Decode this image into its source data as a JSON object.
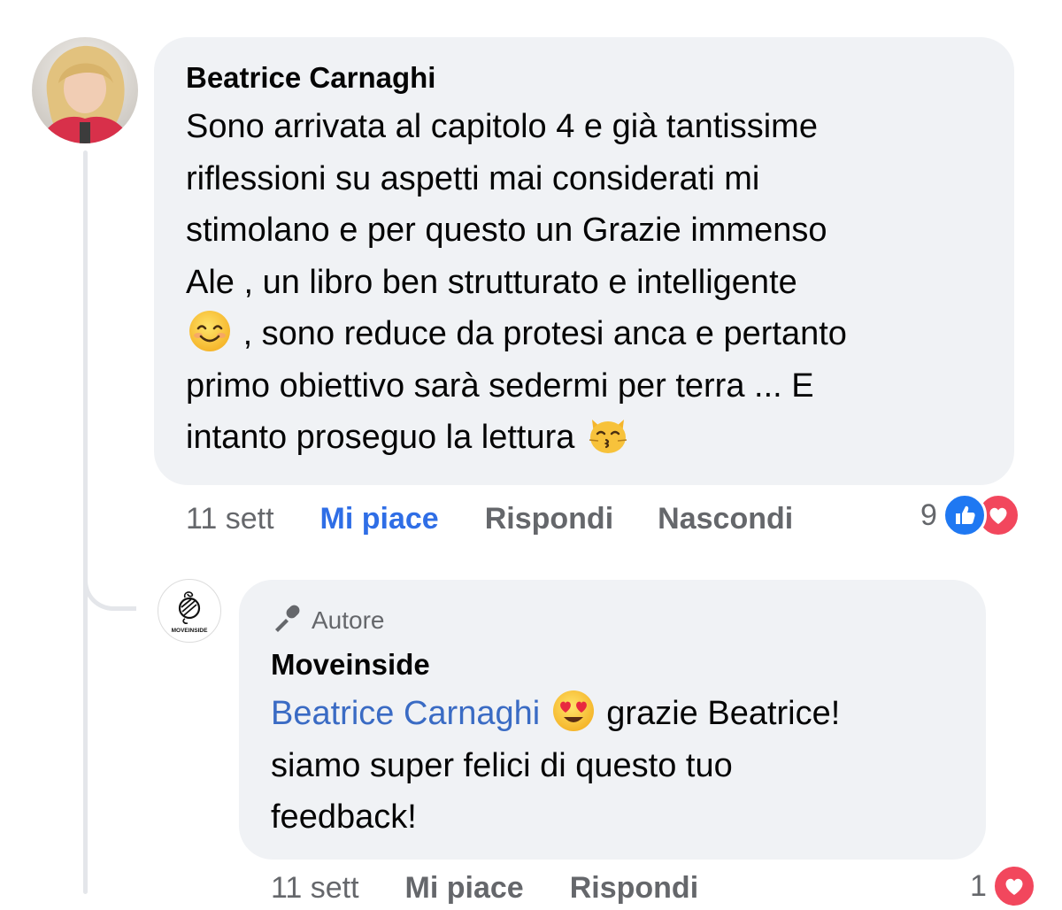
{
  "comment": {
    "author": "Beatrice Carnaghi",
    "lines": [
      "Sono arrivata al capitolo 4 e già tantissime",
      "riflessioni su aspetti mai considerati mi",
      "stimolano e per questo un Grazie immenso",
      "Ale , un libro ben strutturato e intelligente",
      ", sono reduce da protesi anca e pertanto",
      "primo obiettivo sarà sedermi per terra ... E",
      "intanto proseguo la lettura"
    ],
    "timestamp": "11 sett",
    "like_label": "Mi piace",
    "reply_label": "Rispondi",
    "hide_label": "Nascondi",
    "reaction_count": "9",
    "emojis": [
      "smiling-face-emoji",
      "kissing-cat-emoji"
    ]
  },
  "reply": {
    "badge_label": "Autore",
    "author": "Moveinside",
    "mention": "Beatrice Carnaghi",
    "line1_rest": "grazie Beatrice!",
    "line2": "siamo super felici di questo tuo",
    "line3": "feedback!",
    "emoji": "heart-eyes-emoji",
    "avatar_text": "MOVEINSIDE",
    "timestamp": "11 sett",
    "like_label": "Mi piace",
    "reply_label": "Rispondi",
    "reaction_count": "1"
  },
  "colors": {
    "bubble": "#f0f2f5",
    "liked_blue": "#2f6ee6",
    "mention_blue": "#3a6bc4",
    "muted": "#65676b",
    "like_reaction": "#1f78f2",
    "love_reaction": "#f2475d"
  }
}
